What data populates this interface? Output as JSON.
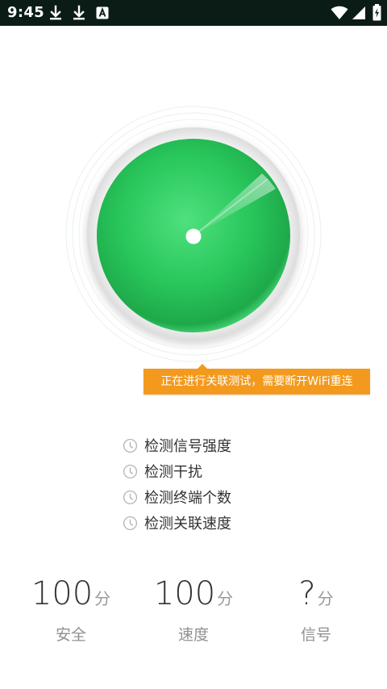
{
  "status_bar": {
    "time": "9:45",
    "icons": [
      "download-icon",
      "download-icon",
      "accessibility-a-icon",
      "wifi-icon",
      "cell-signal-icon",
      "battery-charging-icon"
    ]
  },
  "test": {
    "tooltip": "正在进行关联测试，需要断开WiFi重连"
  },
  "checklist": {
    "items": [
      "检测信号强度",
      "检测干扰",
      "检测终端个数",
      "检测关联速度"
    ]
  },
  "scores": [
    {
      "value": "100",
      "unit": "分",
      "label": "安全"
    },
    {
      "value": "100",
      "unit": "分",
      "label": "速度"
    },
    {
      "value": "?",
      "unit": "分",
      "label": "信号"
    }
  ],
  "colors": {
    "accent_green": "#22c35a",
    "tooltip_orange": "#f39a1e",
    "status_bar": "#0b1c17"
  }
}
